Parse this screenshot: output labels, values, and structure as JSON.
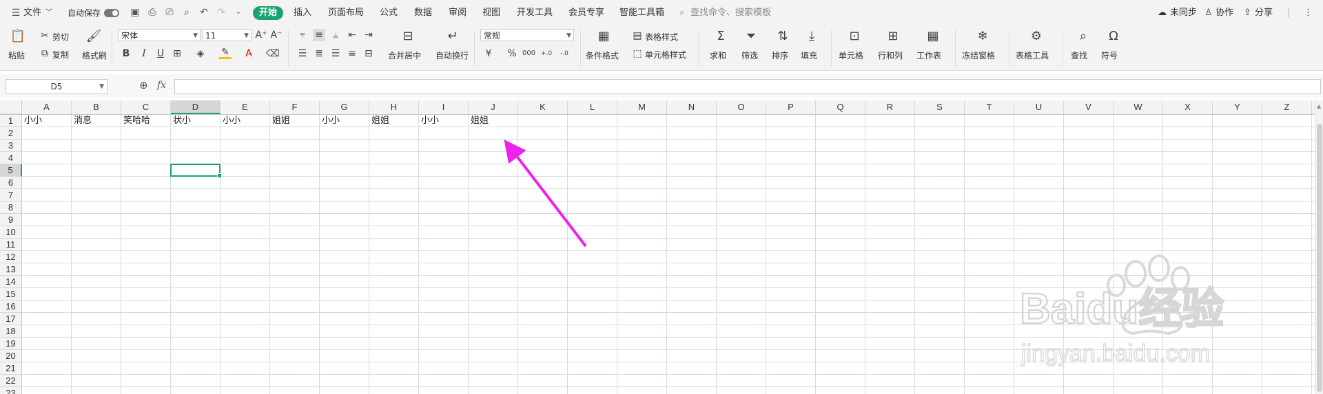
{
  "menubar": {
    "file_label": "文件",
    "autosave_label": "自动保存",
    "tabs": [
      "开始",
      "插入",
      "页面布局",
      "公式",
      "数据",
      "审阅",
      "视图",
      "开发工具",
      "会员专享",
      "智能工具箱"
    ],
    "search_placeholder": "查找命令、搜索模板",
    "unsync_label": "未同步",
    "collab_label": "协作",
    "share_label": "分享"
  },
  "ribbon": {
    "paste": "粘贴",
    "cut": "剪切",
    "copy": "复制",
    "format_painter": "格式刷",
    "font_name": "宋体",
    "font_size": "11",
    "merge_center": "合并居中",
    "wrap_text": "自动换行",
    "number_format": "常规",
    "conditional_format": "条件格式",
    "table_style": "表格样式",
    "cell_style": "单元格样式",
    "sum": "求和",
    "filter": "筛选",
    "sort": "排序",
    "fill": "填充",
    "cell": "单元格",
    "row_col": "行和列",
    "worksheet": "工作表",
    "freeze": "冻结窗格",
    "table_tools": "表格工具",
    "find": "查找",
    "symbol": "符号"
  },
  "formula_bar": {
    "name_box": "D5",
    "fx_label": "fx",
    "formula": ""
  },
  "sheet": {
    "columns": [
      "A",
      "B",
      "C",
      "D",
      "E",
      "F",
      "G",
      "H",
      "I",
      "J",
      "K",
      "L",
      "M",
      "N",
      "O",
      "P",
      "Q",
      "R",
      "S",
      "T",
      "U",
      "V",
      "W",
      "X",
      "Y",
      "Z"
    ],
    "rows": [
      "1",
      "2",
      "3",
      "4",
      "5",
      "6",
      "7",
      "8",
      "9",
      "10",
      "11",
      "12",
      "13",
      "14",
      "15",
      "16",
      "17",
      "18",
      "19",
      "20",
      "21",
      "22",
      "23"
    ],
    "row1_values": [
      "小小",
      "消息",
      "笑哈哈",
      "状小",
      "小小",
      "姐姐",
      "小小",
      "姐姐",
      "小小",
      "姐姐"
    ],
    "active_cell": "D5"
  },
  "watermark": {
    "brand": "Baidu经验",
    "url": "jingyan.baidu.com"
  },
  "colors": {
    "accent": "#1aa36e",
    "arrow": "#ee22ee",
    "gridline": "#d4dbea"
  }
}
